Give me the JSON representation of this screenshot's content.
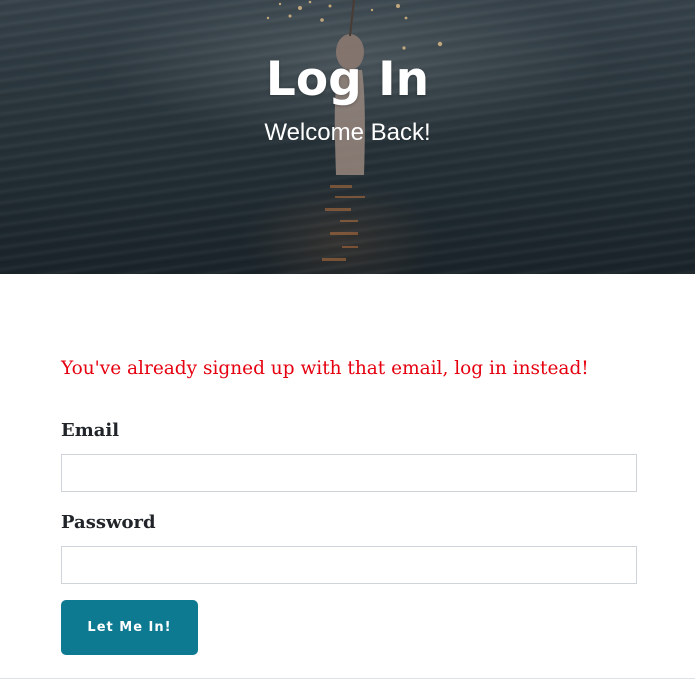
{
  "header": {
    "title": "Log In",
    "subtitle": "Welcome Back!"
  },
  "form": {
    "error_message": "You've already signed up with that email, log in instead!",
    "email_label": "Email",
    "email_value": "",
    "password_label": "Password",
    "password_value": "",
    "submit_label": "Let Me In!"
  },
  "colors": {
    "accent": "#0e7a92",
    "error": "#e6000f",
    "text": "#212529"
  }
}
